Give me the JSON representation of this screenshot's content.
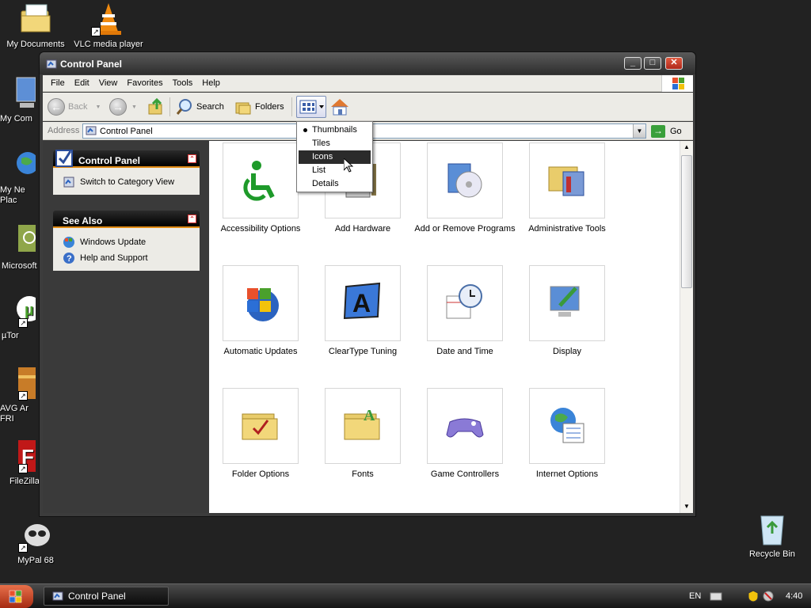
{
  "desktop": {
    "icons": [
      {
        "label": "My Documents"
      },
      {
        "label": "VLC media player"
      },
      {
        "label": "My Com"
      },
      {
        "label": "My Ne\nPlac"
      },
      {
        "label": "Microsoft"
      },
      {
        "label": "µTor"
      },
      {
        "label": "AVG Ar\nFRI"
      },
      {
        "label": "FileZilla"
      },
      {
        "label": "MyPal 68"
      },
      {
        "label": "Recycle Bin"
      }
    ]
  },
  "window": {
    "title": "Control Panel",
    "controls": {
      "minimize": "_",
      "maximize": "□",
      "close": "✕"
    }
  },
  "menubar": [
    "File",
    "Edit",
    "View",
    "Favorites",
    "Tools",
    "Help"
  ],
  "toolbar": {
    "back": "Back",
    "search": "Search",
    "folders": "Folders"
  },
  "address": {
    "label": "Address",
    "value": "Control Panel",
    "go": "Go"
  },
  "sidebar": {
    "control_panel": {
      "title": "Control Panel",
      "links": [
        "Switch to Category View"
      ]
    },
    "see_also": {
      "title": "See Also",
      "links": [
        "Windows Update",
        "Help and Support"
      ]
    }
  },
  "view_menu": {
    "options": [
      "Thumbnails",
      "Tiles",
      "Icons",
      "List",
      "Details"
    ],
    "checked": "Thumbnails",
    "highlighted": "Icons"
  },
  "items": [
    {
      "label": "Accessibility Options",
      "icon": "accessibility-icon"
    },
    {
      "label": "Add Hardware",
      "icon": "add-hardware-icon"
    },
    {
      "label": "Add or Remove Programs",
      "icon": "add-remove-programs-icon"
    },
    {
      "label": "Administrative Tools",
      "icon": "administrative-tools-icon"
    },
    {
      "label": "Automatic Updates",
      "icon": "automatic-updates-icon"
    },
    {
      "label": "ClearType Tuning",
      "icon": "cleartype-icon"
    },
    {
      "label": "Date and Time",
      "icon": "date-time-icon"
    },
    {
      "label": "Display",
      "icon": "display-icon"
    },
    {
      "label": "Folder Options",
      "icon": "folder-options-icon"
    },
    {
      "label": "Fonts",
      "icon": "fonts-icon"
    },
    {
      "label": "Game Controllers",
      "icon": "game-controllers-icon"
    },
    {
      "label": "Internet Options",
      "icon": "internet-options-icon"
    }
  ],
  "taskbar": {
    "task": "Control Panel",
    "language": "EN",
    "time": "4:40"
  }
}
